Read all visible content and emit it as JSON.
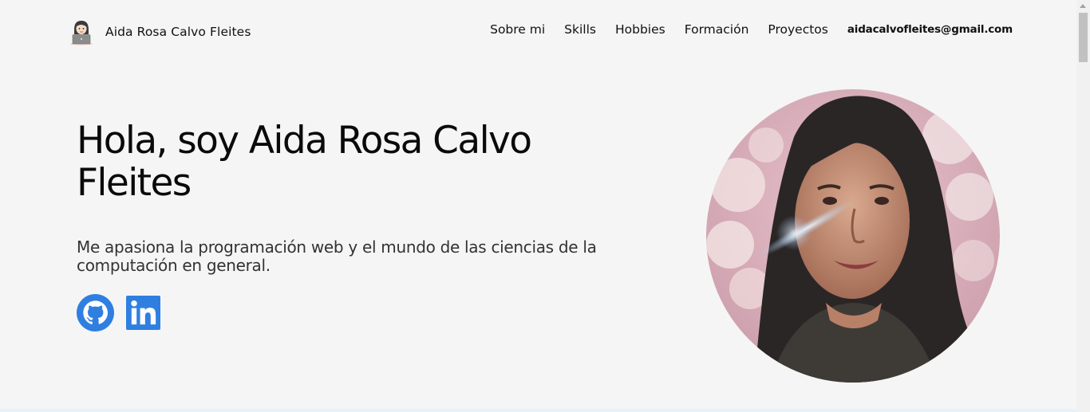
{
  "navbar": {
    "brand_name": "Aida Rosa Calvo Fleites",
    "brand_icon": "woman-technologist-icon",
    "links": [
      {
        "label": "Sobre mi"
      },
      {
        "label": "Skills"
      },
      {
        "label": "Hobbies"
      },
      {
        "label": "Formación"
      },
      {
        "label": "Proyectos"
      }
    ],
    "email": "aidacalvofleites@gmail.com"
  },
  "hero": {
    "title": "Hola, soy Aida Rosa Calvo Fleites",
    "subtitle": "Me apasiona la programación web y el mundo de las ciencias de la computación en general.",
    "social": [
      {
        "name": "github",
        "icon": "github-icon",
        "color": "#2f7fe0"
      },
      {
        "name": "linkedin",
        "icon": "linkedin-icon",
        "color": "#2f7fe0"
      }
    ]
  },
  "colors": {
    "background": "#f5f5f5",
    "accent": "#2f7fe0",
    "text": "#111111"
  }
}
